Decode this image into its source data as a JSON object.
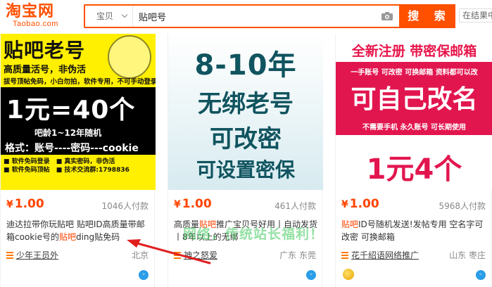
{
  "header": {
    "logo_main": "淘宝网",
    "logo_sub": "Taobao.com",
    "search_scope": "宝贝",
    "search_query": "贴吧号",
    "search_button": "搜 索",
    "extra_label": "在结果中搜"
  },
  "products": [
    {
      "thumb": {
        "title": "贴吧老号",
        "sub": "高质量活号，非伪活",
        "sub2": "拔号顶帖免码，小白勿拍，软件专用，不可手动登录",
        "price": "1元=40个",
        "age": "吧龄1~12年随机",
        "format": "格式：账号----密码---cookie",
        "features": [
          "■ 软件免码登录",
          "■ 真实密码，非伪活",
          "■ 软件免码顶帖",
          "■ 技术交流群:1798836"
        ]
      },
      "price": "1.00",
      "currency": "¥",
      "sales": "1046人付款",
      "title_parts": [
        "迪达拉带你玩贴吧 贴吧ID高质量带邮箱cookie号的",
        "贴吧",
        "ding贴免码"
      ],
      "shop": "少年王员外",
      "location": "北京"
    },
    {
      "thumb": {
        "line1": "8-10年",
        "line2": "无绑老号",
        "line3": "可改密",
        "line4": "可设置密保"
      },
      "price": "1.00",
      "currency": "¥",
      "sales": "461人付款",
      "title_parts": [
        "高质量",
        "贴吧",
        "推广宝贝号好用丨自动发货丨8年以上的无绑"
      ],
      "shop": "神之怒爱",
      "location": "广东 东莞"
    },
    {
      "thumb": {
        "top": "全新注册 带密保邮箱",
        "band_line": "一手账号 可改密 可换邮箱 资料都可以改",
        "big": "可自己改名",
        "band_line2": "不需要手机 永久账号 可长期使用",
        "price": "1元4个"
      },
      "price": "1.00",
      "currency": "¥",
      "sales": "5968人付款",
      "title_parts": [
        "",
        "贴吧",
        "ID号随机发送!发帖专用 空名字可改密 可换邮箱"
      ],
      "shop": "花千绍语网络推广",
      "location": "山东 枣庄"
    }
  ],
  "watermark": "网络，传统站长福利！",
  "colors": {
    "brand": "#ff5000",
    "price": "#ff4400",
    "pink": "#e2164f",
    "teal": "#10545f",
    "yellow": "#ffef00"
  }
}
